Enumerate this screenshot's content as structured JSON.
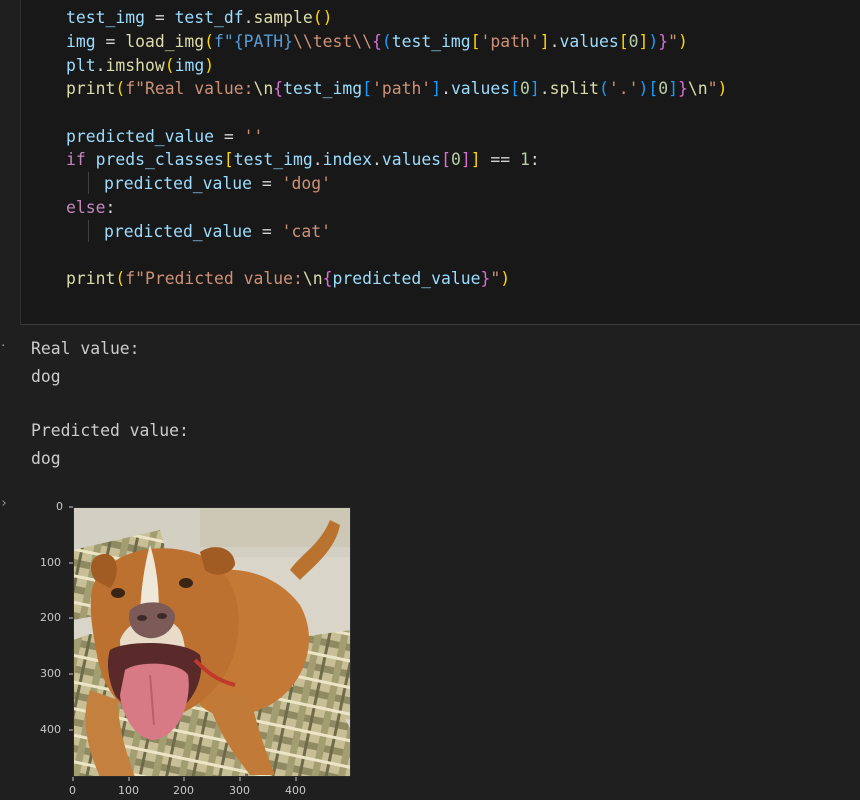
{
  "code": {
    "line1": {
      "a": "test_img",
      "b": " = ",
      "c": "test_df",
      "d": ".",
      "e": "sample",
      "f": "()"
    },
    "line2": {
      "a": "img",
      "b": " = ",
      "c": "load_img",
      "d": "(",
      "e": "f\"",
      "f": "{PATH}",
      "g": "\\\\test\\\\",
      "h": "{",
      "i": "(",
      "j": "test_img",
      "k": "[",
      "l": "'path'",
      "m": "]",
      "n": ".",
      "o": "values",
      "p": "[",
      "q": "0",
      "r": "]",
      "s": ")",
      "t": "}",
      "u": "\"",
      "w": ")"
    },
    "line3": {
      "a": "plt",
      "b": ".",
      "c": "imshow",
      "d": "(",
      "e": "img",
      "f": ")"
    },
    "line4": {
      "a": "print",
      "b": "(",
      "c": "f\"Real value:",
      "d": "\\n",
      "e": "{",
      "f": "test_img",
      "g": "[",
      "h": "'path'",
      "i": "]",
      "j": ".",
      "k": "values",
      "l": "[",
      "m": "0",
      "n": "]",
      "o": ".",
      "p": "split",
      "q": "(",
      "r": "'.'",
      "s": ")",
      "t": "[",
      "u": "0",
      "w": "]",
      "x": "}",
      "y": "\\n",
      "z": "\"",
      "aa": ")"
    },
    "line5": {
      "a": "predicted_value",
      "b": " = ",
      "c": "''"
    },
    "line6": {
      "a": "if",
      "b": " ",
      "c": "preds_classes",
      "d": "[",
      "e": "test_img",
      "f": ".",
      "g": "index",
      "h": ".",
      "i": "values",
      "j": "[",
      "k": "0",
      "l": "]",
      "m": "]",
      "n": " == ",
      "o": "1",
      "p": ":"
    },
    "line7": {
      "a": "predicted_value",
      "b": " = ",
      "c": "'dog'"
    },
    "line8": {
      "a": "else",
      "b": ":"
    },
    "line9": {
      "a": "predicted_value",
      "b": " = ",
      "c": "'cat'"
    },
    "line10": {
      "a": "print",
      "b": "(",
      "c": "f\"Predicted value:",
      "d": "\\n",
      "e": "{",
      "f": "predicted_value",
      "g": "}",
      "h": "\"",
      "i": ")"
    }
  },
  "output": {
    "lines": [
      "Real value:",
      "dog",
      "Predicted value:",
      "dog"
    ]
  },
  "plot": {
    "y_ticks": [
      "0",
      "100",
      "200",
      "300",
      "400"
    ],
    "x_ticks": [
      "0",
      "100",
      "200",
      "300",
      "400"
    ],
    "image_subject": "dog"
  }
}
